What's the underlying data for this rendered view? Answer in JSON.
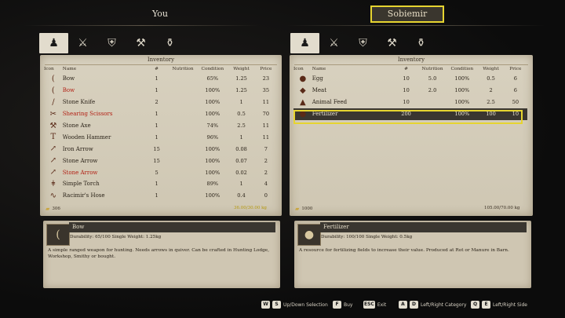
{
  "you_title": "You",
  "other_title": "Sobiemir",
  "tabs": [
    {
      "icon": "person-silhouette-icon",
      "glyph": "♟"
    },
    {
      "icon": "weapons-icon",
      "glyph": "⚔"
    },
    {
      "icon": "armor-icon",
      "glyph": "⛨"
    },
    {
      "icon": "anvil-icon",
      "glyph": "⚒"
    },
    {
      "icon": "sack-icon",
      "glyph": "⚱"
    }
  ],
  "inventory_title": "Inventory",
  "columns": [
    "Icon",
    "Name",
    "#",
    "Nutrition",
    "Condition",
    "Weight",
    "Price"
  ],
  "left_items": [
    {
      "icon": "bow-icon",
      "glyph": "(",
      "name": "Bow",
      "red": false,
      "qty": "1",
      "nutrition": "",
      "condition": "65%",
      "weight": "1.25",
      "price": "23"
    },
    {
      "icon": "bow-icon",
      "glyph": "(",
      "name": "Bow",
      "red": true,
      "qty": "1",
      "nutrition": "",
      "condition": "100%",
      "weight": "1.25",
      "price": "35"
    },
    {
      "icon": "stone-knife-icon",
      "glyph": "/",
      "name": "Stone Knife",
      "red": false,
      "qty": "2",
      "nutrition": "",
      "condition": "100%",
      "weight": "1",
      "price": "11"
    },
    {
      "icon": "scissors-icon",
      "glyph": "✂",
      "name": "Shearing Scissors",
      "red": true,
      "qty": "1",
      "nutrition": "",
      "condition": "100%",
      "weight": "0.5",
      "price": "70"
    },
    {
      "icon": "stone-axe-icon",
      "glyph": "⚒",
      "name": "Stone Axe",
      "red": false,
      "qty": "1",
      "nutrition": "",
      "condition": "74%",
      "weight": "2.5",
      "price": "11"
    },
    {
      "icon": "hammer-icon",
      "glyph": "T",
      "name": "Wooden Hammer",
      "red": false,
      "qty": "1",
      "nutrition": "",
      "condition": "96%",
      "weight": "1",
      "price": "11"
    },
    {
      "icon": "iron-arrow-icon",
      "glyph": "↗",
      "name": "Iron Arrow",
      "red": false,
      "qty": "15",
      "nutrition": "",
      "condition": "100%",
      "weight": "0.08",
      "price": "7"
    },
    {
      "icon": "stone-arrow-icon",
      "glyph": "↗",
      "name": "Stone Arrow",
      "red": false,
      "qty": "15",
      "nutrition": "",
      "condition": "100%",
      "weight": "0.07",
      "price": "2"
    },
    {
      "icon": "stone-arrow-icon",
      "glyph": "↗",
      "name": "Stone Arrow",
      "red": true,
      "qty": "5",
      "nutrition": "",
      "condition": "100%",
      "weight": "0.02",
      "price": "2"
    },
    {
      "icon": "torch-icon",
      "glyph": "ǂ",
      "name": "Simple Torch",
      "red": false,
      "qty": "1",
      "nutrition": "",
      "condition": "89%",
      "weight": "1",
      "price": "4"
    },
    {
      "icon": "hose-icon",
      "glyph": "∿",
      "name": "Racimir's Hose",
      "red": false,
      "qty": "1",
      "nutrition": "",
      "condition": "100%",
      "weight": "0.4",
      "price": "0"
    }
  ],
  "right_items": [
    {
      "icon": "egg-icon",
      "glyph": "●",
      "name": "Egg",
      "red": false,
      "qty": "10",
      "nutrition": "5.0",
      "condition": "100%",
      "weight": "0.5",
      "price": "6"
    },
    {
      "icon": "meat-icon",
      "glyph": "◆",
      "name": "Meat",
      "red": false,
      "qty": "10",
      "nutrition": "2.0",
      "condition": "100%",
      "weight": "2",
      "price": "6"
    },
    {
      "icon": "animal-feed-icon",
      "glyph": "▲",
      "name": "Animal Feed",
      "red": false,
      "qty": "10",
      "nutrition": "",
      "condition": "100%",
      "weight": "2.5",
      "price": "50"
    },
    {
      "icon": "fertilizer-icon",
      "glyph": "●",
      "name": "Fertilizer",
      "red": false,
      "qty": "200",
      "nutrition": "",
      "condition": "100%",
      "weight": "100",
      "price": "10"
    }
  ],
  "left_status": {
    "money": "306",
    "capacity": "36.00/30.00 kg"
  },
  "right_status": {
    "money": "1000",
    "capacity": "105.00/70.00 kg"
  },
  "left_detail": {
    "icon": "bow-icon",
    "title": "Bow",
    "stats": "Durability: 65/100   Single Weight: 1.25kg",
    "desc": "A simple ranged weapon for hunting. Needs arrows in quiver. Can be crafted in Hunting Lodge, Workshop, Smithy or bought."
  },
  "right_detail": {
    "icon": "fertilizer-icon",
    "title": "Fertilizer",
    "stats": "Durability: 100/100   Single Weight: 0.5kg",
    "desc": "A resource for fertilizing fields to increase their value. Produced at Rot or Manure in Barn."
  },
  "hints": [
    {
      "keys": [
        "W",
        "S"
      ],
      "label": "Up/Down Selection"
    },
    {
      "keys": [
        "F"
      ],
      "label": "Buy"
    },
    {
      "keys": [
        "ESC"
      ],
      "label": "Exit"
    },
    {
      "keys": [
        "A",
        "D"
      ],
      "label": "Left/Right Category"
    },
    {
      "keys": [
        "Q",
        "E"
      ],
      "label": "Left/Right Side"
    }
  ],
  "colors": {
    "highlight": "#e6d430",
    "red_item": "#b21e12",
    "parchment": "#d8d1bf"
  }
}
